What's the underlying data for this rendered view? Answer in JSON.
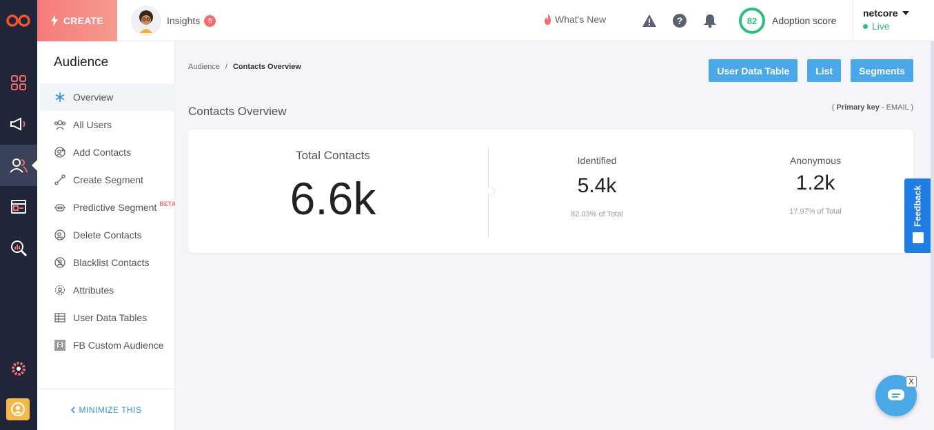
{
  "topbar": {
    "create_label": "CREATE",
    "insights_label": "Insights",
    "insights_badge": "5",
    "whats_new_label": "What's New",
    "adoption_score": "82",
    "adoption_label": "Adoption score",
    "account_name": "netcore",
    "account_status": "Live"
  },
  "subnav": {
    "title": "Audience",
    "items": [
      {
        "label": "Overview",
        "icon": "snowflake-icon"
      },
      {
        "label": "All Users",
        "icon": "users-icon"
      },
      {
        "label": "Add Contacts",
        "icon": "add-user-icon"
      },
      {
        "label": "Create Segment",
        "icon": "segment-icon"
      },
      {
        "label": "Predictive Segment",
        "icon": "robot-icon",
        "badge": "BETA"
      },
      {
        "label": "Delete Contacts",
        "icon": "delete-user-icon"
      },
      {
        "label": "Blacklist Contacts",
        "icon": "block-user-icon"
      },
      {
        "label": "Attributes",
        "icon": "attributes-icon"
      },
      {
        "label": "User Data Tables",
        "icon": "table-icon"
      },
      {
        "label": "FB Custom Audience",
        "icon": "fb-audience-icon"
      }
    ],
    "minimize_label": "MINIMIZE THIS"
  },
  "main": {
    "breadcrumb": {
      "root": "Audience",
      "sep": "/",
      "current": "Contacts Overview"
    },
    "actions": [
      "User Data Table",
      "List",
      "Segments"
    ],
    "section_title": "Contacts Overview",
    "primary_key": {
      "open": "( ",
      "label": "Primary key",
      "value": " - EMAIL )"
    },
    "total": {
      "label": "Total Contacts",
      "value": "6.6k"
    },
    "identified": {
      "label": "Identified",
      "value": "5.4k",
      "pct": "82.03% of Total"
    },
    "anonymous": {
      "label": "Anonymous",
      "value": "1.2k",
      "pct": "17.97% of Total"
    }
  },
  "feedback_label": "Feedback",
  "chat_close": "X",
  "colors": {
    "accent": "#4aa8e8",
    "create": "#f67a7a",
    "live": "#2bbd7e",
    "rail": "#202637"
  }
}
